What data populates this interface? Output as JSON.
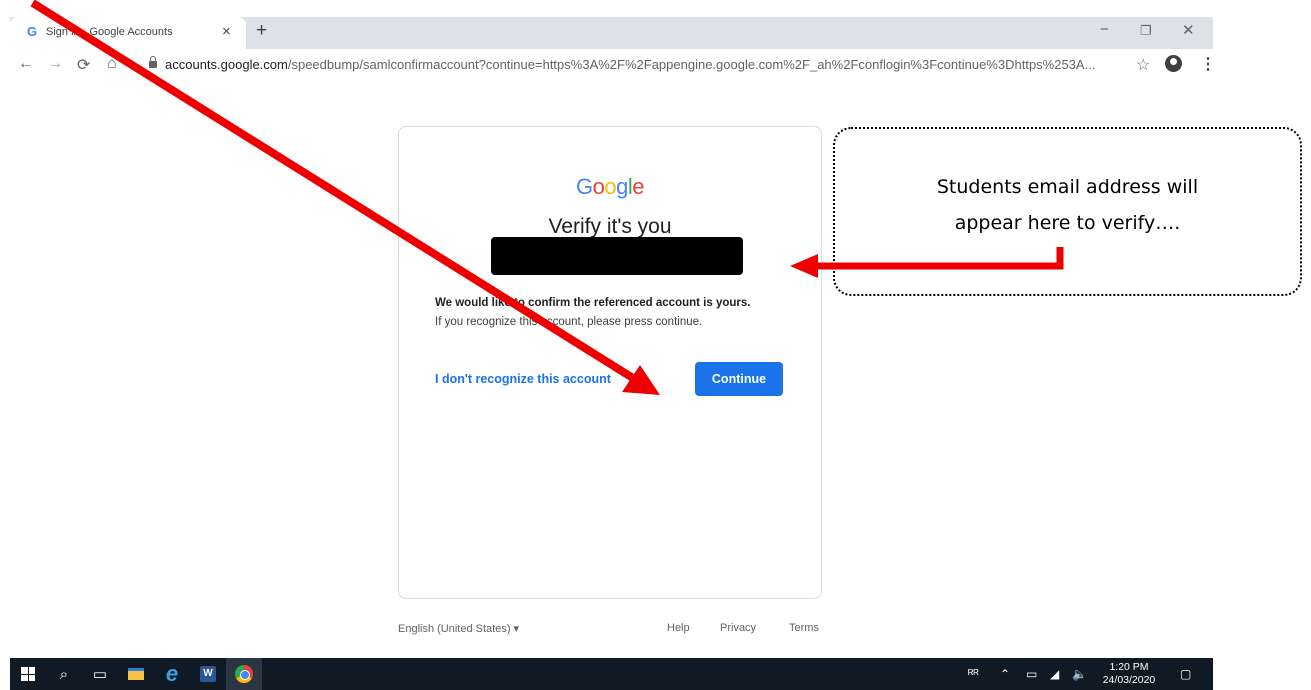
{
  "browser": {
    "tab": {
      "favicon": "G",
      "title": "Sign in - Google Accounts",
      "close": "×"
    },
    "newtab": "+",
    "window_controls": {
      "minimize": "−",
      "maximize": "❐",
      "close": "✕"
    },
    "nav": {
      "back": "←",
      "forward": "→",
      "reload": "⟳",
      "home": "⌂"
    },
    "url": {
      "domain": "accounts.google.com",
      "path": "/speedbump/samlconfirmaccount?continue=https%3A%2F%2Fappengine.google.com%2F_ah%2Fconflogin%3Fcontinue%3Dhttps%253A..."
    },
    "bookmark_star": "☆",
    "menu": "⋮"
  },
  "card": {
    "logo_letters": [
      "G",
      "o",
      "o",
      "g",
      "l",
      "e"
    ],
    "heading": "Verify it's you",
    "confirm_text": "We would like to confirm the referenced account is yours.",
    "recognize_text": "If you recognize this account, please press continue.",
    "unrecognized_link": "I don't recognize this account",
    "continue_button": "Continue"
  },
  "footer": {
    "language": "English (United States)  ▾",
    "help": "Help",
    "privacy": "Privacy",
    "terms": "Terms"
  },
  "annotation": {
    "callout_line1": "Students email address will",
    "callout_line2": "appear here to verify….",
    "arrow_color": "#ee0000"
  },
  "taskbar": {
    "search_icon": "⌕",
    "taskview_icon": "▭",
    "ie_icon": "e",
    "word_icon": "W",
    "tray_people": "ᴿᴿ",
    "tray_chevron": "⌃",
    "tray_battery": "▭",
    "tray_wifi": "◢",
    "tray_volume": "🔈",
    "notify_icon": "▢",
    "time": "1:20 PM",
    "date": "24/03/2020"
  }
}
